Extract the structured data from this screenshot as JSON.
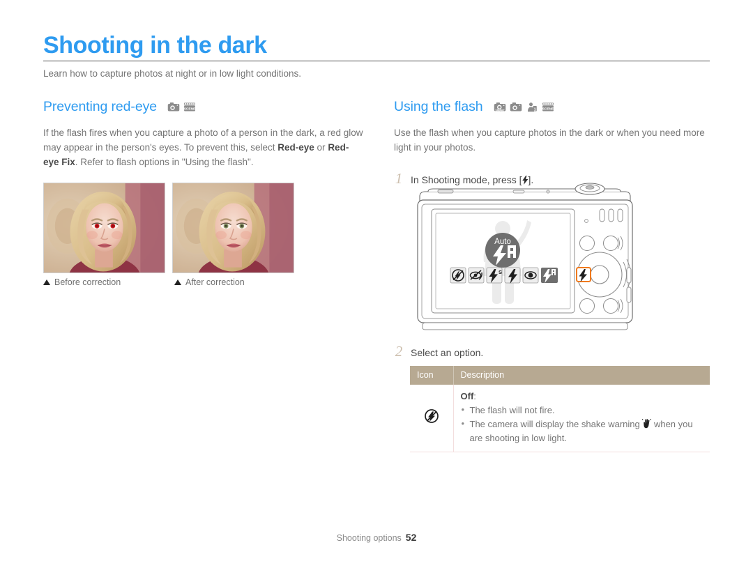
{
  "header": {
    "title": "Shooting in the dark",
    "intro": "Learn how to capture photos at night or in low light conditions.",
    "accent_color": "#2e9bf0"
  },
  "left_section": {
    "heading": "Preventing red-eye",
    "mode_icons": [
      "program-mode-icon",
      "scene-mode-icon"
    ],
    "paragraph_parts": {
      "p1": "If the flash fires when you capture a photo of a person in the dark, a red glow may appear in the person's eyes. To prevent this, select ",
      "bold1": "Red-eye",
      "mid": " or ",
      "bold2": "Red-eye Fix",
      "p2": ". Refer to flash options in \"Using the flash\"."
    },
    "photos": [
      {
        "caption": "Before correction",
        "alt": "portrait-with-red-eye"
      },
      {
        "caption": "After correction",
        "alt": "portrait-red-eye-corrected"
      }
    ]
  },
  "right_section": {
    "heading": "Using the flash",
    "mode_icons": [
      "smart-auto-mode-icon",
      "program-mode-icon",
      "dual-is-mode-icon",
      "scene-mode-icon"
    ],
    "paragraph": "Use the flash when you capture photos in the dark or when you need more light in your photos.",
    "steps": [
      {
        "number": "1",
        "text_before": "In Shooting mode, press [",
        "icon": "flash-button-icon",
        "text_after": "]."
      },
      {
        "number": "2",
        "text_before": "Select an option.",
        "icon": "",
        "text_after": ""
      }
    ],
    "camera": {
      "lcd_badge_label": "Auto",
      "lcd_badge_icon": "flash-auto-icon",
      "flash_option_icons": [
        "flash-off-icon",
        "red-eye-fix-icon",
        "slow-sync-icon",
        "fill-in-icon",
        "red-eye-icon",
        "flash-auto-icon-selected"
      ],
      "highlighted_button": "flash-button",
      "highlight_color": "#f07a1e"
    },
    "table": {
      "header_color": "#b7a992",
      "columns": [
        "Icon",
        "Description"
      ],
      "rows": [
        {
          "icon": "flash-off-icon",
          "option_name": "Off",
          "option_suffix": ":",
          "bullets": [
            {
              "text_before": "The flash will not fire.",
              "icon": "",
              "text_after": ""
            },
            {
              "text_before": "The camera will display the shake warning ",
              "icon": "shake-warning-icon",
              "text_after": " when you are shooting in low light."
            }
          ]
        }
      ]
    }
  },
  "footer": {
    "section_label": "Shooting options",
    "page_number": "52"
  }
}
